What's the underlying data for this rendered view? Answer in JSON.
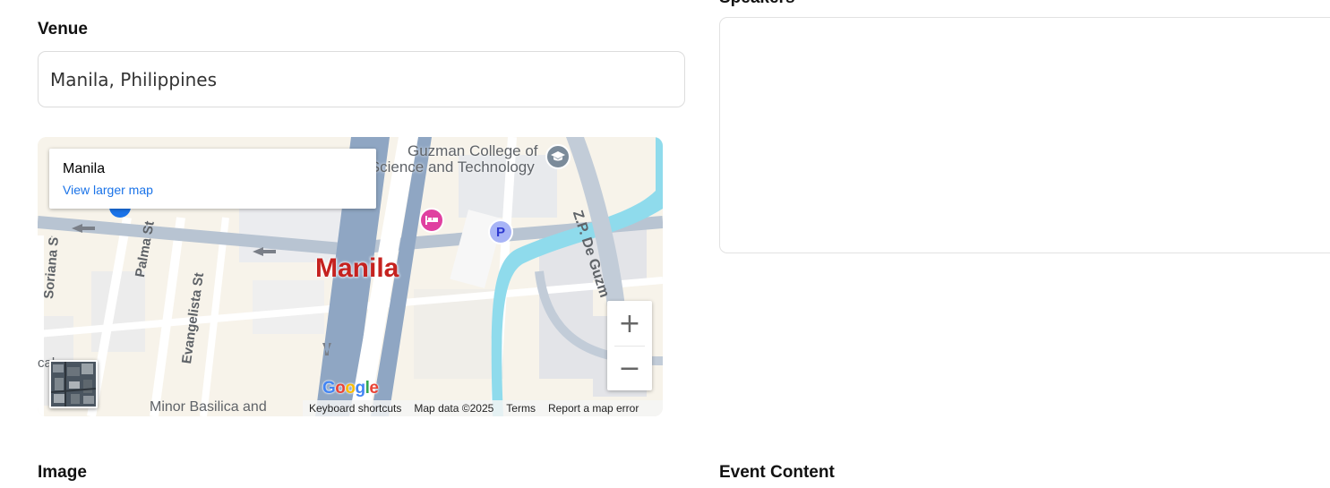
{
  "venue": {
    "label": "Venue",
    "value": "Manila, Philippines"
  },
  "speakers": {
    "label": "Speakers"
  },
  "map": {
    "info_card": {
      "title": "Manila",
      "link": "View larger map"
    },
    "labels": {
      "city": "Manila",
      "college_line1": "Guzman College of",
      "college_line2": "Science and Technology",
      "street_zp": "Z.P. De Guzm",
      "street_palma": "Palma St",
      "street_evangelista": "Evangelista St",
      "street_left": "Soriana St",
      "place_left": "cal",
      "basilica": "Minor Basilica and",
      "parking": "P",
      "google": "Google"
    },
    "zoom": {
      "in": "+",
      "out": "−"
    },
    "attribution": {
      "shortcuts": "Keyboard shortcuts",
      "data": "Map data ©2025",
      "terms": "Terms",
      "report": "Report a map error"
    },
    "icons": {
      "school": "graduation-cap-icon",
      "hotel": "hotel-icon",
      "parking": "parking-icon"
    }
  },
  "image": {
    "label": "Image"
  },
  "event_content": {
    "label": "Event Content"
  },
  "colors": {
    "map_land": "#f2efe9",
    "map_block": "#e8eaed",
    "map_road": "#ffffff",
    "map_highway": "#8aa4c4",
    "map_water": "#8fdbec",
    "city_label": "#c5221f",
    "link": "#1a73e8",
    "hotel_pin": "#e040a0",
    "parking_pin": "#7b8cf2"
  }
}
